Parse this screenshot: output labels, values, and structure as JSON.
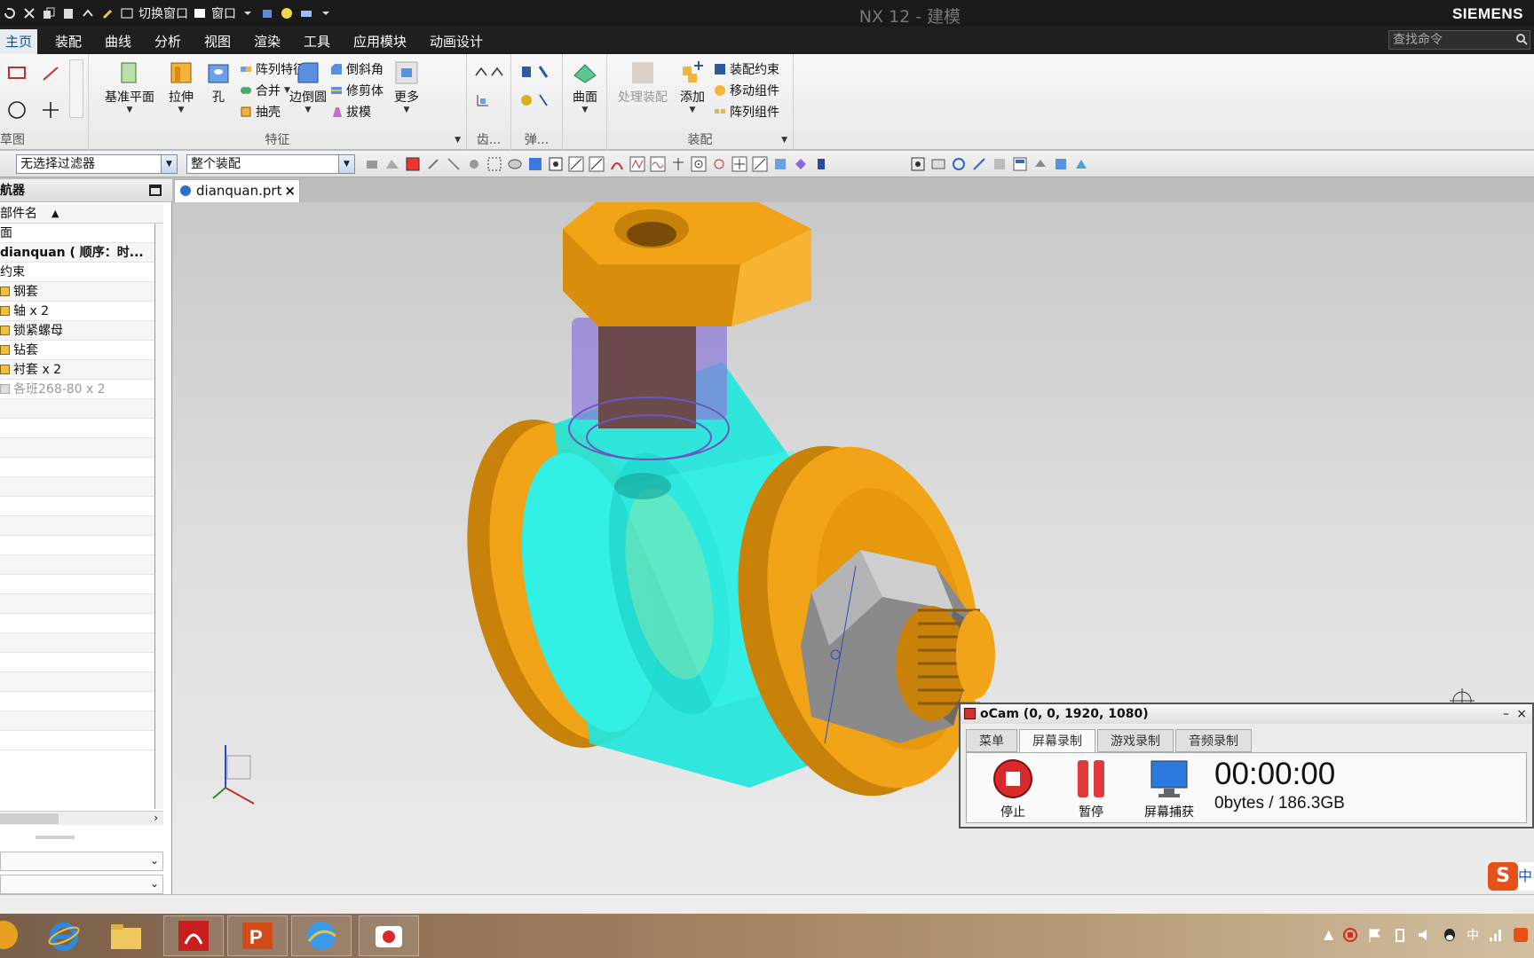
{
  "titlebar": {
    "app_title": "NX 12 - 建模",
    "brand": "SIEMENS",
    "switch_window": "切换窗口",
    "window_menu": "窗口"
  },
  "menu": {
    "tabs": [
      "主页",
      "装配",
      "曲线",
      "分析",
      "视图",
      "渲染",
      "工具",
      "应用模块",
      "动画设计"
    ],
    "active_tab": "主页",
    "search_placeholder": "查找命令"
  },
  "ribbon": {
    "sketch_group": "草图",
    "feature_group": "特征",
    "gear_group": "齿...",
    "spring_group": "弹...",
    "assembly_group": "装配",
    "datum_plane": "基准平面",
    "extrude": "拉伸",
    "hole": "孔",
    "pattern_feature": "阵列特征",
    "unite": "合并",
    "shell": "抽壳",
    "edge_blend": "边倒圆",
    "chamfer": "倒斜角",
    "trim_body": "修剪体",
    "draft": "拔模",
    "more": "更多",
    "surface": "曲面",
    "process_assembly": "处理装配",
    "add": "添加",
    "assembly_constraint": "装配约束",
    "move_component": "移动组件",
    "pattern_component": "阵列组件"
  },
  "filterbar": {
    "selection_filter": "无选择过滤器",
    "scope": "整个装配"
  },
  "navigator": {
    "title": "航器",
    "column_header": "部件名",
    "rows": [
      {
        "label": "面",
        "bold": false,
        "icon": "",
        "dim": false
      },
      {
        "label": "dianquan ( 顺序：时...",
        "bold": true,
        "icon": "",
        "dim": false
      },
      {
        "label": "约束",
        "bold": false,
        "icon": "",
        "dim": false
      },
      {
        "label": "钢套",
        "bold": false,
        "icon": "part-icon",
        "dim": false
      },
      {
        "label": "轴 x 2",
        "bold": false,
        "icon": "part-icon",
        "dim": false
      },
      {
        "label": "锁紧螺母",
        "bold": false,
        "icon": "part-icon",
        "dim": false
      },
      {
        "label": "钻套",
        "bold": false,
        "icon": "part-icon",
        "dim": false
      },
      {
        "label": "衬套 x 2",
        "bold": false,
        "icon": "part-icon",
        "dim": false
      },
      {
        "label": "各班268-80 x 2",
        "bold": false,
        "icon": "part-icon",
        "dim": true
      }
    ]
  },
  "document": {
    "tab_name": "dianquan.prt"
  },
  "ocam": {
    "title": "oCam (0, 0, 1920, 1080)",
    "tabs": [
      "菜单",
      "屏幕录制",
      "游戏录制",
      "音频录制"
    ],
    "active_tab": "屏幕录制",
    "stop": "停止",
    "pause": "暂停",
    "capture": "屏幕捕获",
    "time": "00:00:00",
    "size": "0bytes / 186.3GB"
  },
  "taskbar": {
    "apps": [
      "ie-icon",
      "explorer-icon",
      "acrobat-icon",
      "powerpoint-icon",
      "globe-icon",
      "ocam-icon"
    ],
    "ime": "中"
  },
  "colors": {
    "orange": "#f2a418",
    "cyan": "#22e6dc",
    "purple": "#8c78d8",
    "gray_nut": "#8a8a8a",
    "accent": "#0055aa"
  }
}
